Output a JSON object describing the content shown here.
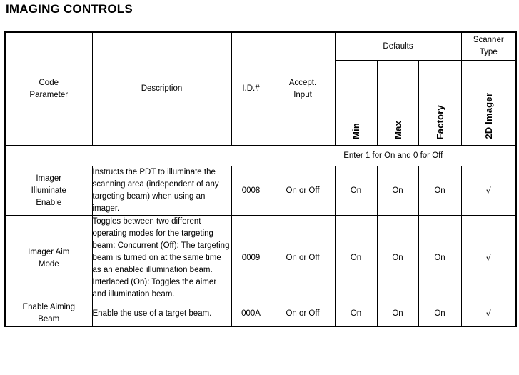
{
  "page": {
    "title": "IMAGING CONTROLS"
  },
  "table": {
    "headers": {
      "code_parameter": "Code\nParameter",
      "code_parameter_line1": "Code",
      "code_parameter_line2": "Parameter",
      "description": "Description",
      "id_number": "I.D.#",
      "accept_input_line1": "Accept.",
      "accept_input_line2": "Input",
      "defaults_group": "Defaults",
      "scanner_type_line1": "Scanner",
      "scanner_type_line2": "Type",
      "min": "Min",
      "max": "Max",
      "factory": "Factory",
      "imager_2d": "2D Imager"
    },
    "note_row": {
      "text": "Enter 1 for On and 0 for Off"
    },
    "rows": [
      {
        "parameter_line1": "Imager",
        "parameter_line2": "Illuminate",
        "parameter_line3": "Enable",
        "description": "Instructs the PDT to illuminate the scanning area (independent of any targeting beam) when using an imager.",
        "id": "0008",
        "accept_input": "On or Off",
        "min": "On",
        "max": "On",
        "factory": "On",
        "imager_2d": "√"
      },
      {
        "parameter_line1": "Imager Aim",
        "parameter_line2": "Mode",
        "parameter_line3": "",
        "description": "Toggles between two different operating modes for the targeting beam: Concurrent (Off): The targeting beam is turned on at the same time as an enabled illumination beam. Interlaced (On): Toggles the aimer and illumination beam.",
        "id": "0009",
        "accept_input": "On or Off",
        "min": "On",
        "max": "On",
        "factory": "On",
        "imager_2d": "√"
      },
      {
        "parameter_line1": "Enable Aiming",
        "parameter_line2": "Beam",
        "parameter_line3": "",
        "description": "Enable the use of a target beam.",
        "id": "000A",
        "accept_input": "On or Off",
        "min": "On",
        "max": "On",
        "factory": "On",
        "imager_2d": "√"
      }
    ]
  }
}
